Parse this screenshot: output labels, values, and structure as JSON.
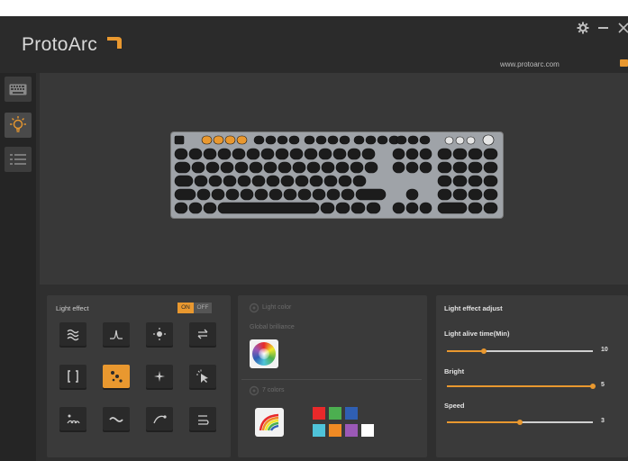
{
  "app": {
    "brand": "ProtoArc",
    "url": "www.protoarc.com",
    "window_controls": {
      "settings_icon": "gear-icon",
      "minimize_icon": "minimize-icon",
      "close_icon": "close-icon"
    }
  },
  "sidebar": {
    "items": [
      {
        "name": "keyboard",
        "icon": "keyboard-icon",
        "active": false
      },
      {
        "name": "lighting",
        "icon": "lightbulb-icon",
        "active": true
      },
      {
        "name": "macro",
        "icon": "list-icon",
        "active": false
      }
    ]
  },
  "light_effect": {
    "title": "Light effect",
    "on_label": "ON",
    "off_label": "OFF",
    "effects": [
      {
        "icon": "wave-icon"
      },
      {
        "icon": "pulse-icon"
      },
      {
        "icon": "sun-icon"
      },
      {
        "icon": "swap-arrows-icon"
      },
      {
        "icon": "bracket-icon"
      },
      {
        "icon": "dots-icon",
        "selected": true
      },
      {
        "icon": "sparkle-icon"
      },
      {
        "icon": "cursor-click-icon"
      },
      {
        "icon": "ripple-icon"
      },
      {
        "icon": "snake-icon"
      },
      {
        "icon": "curve-icon"
      },
      {
        "icon": "loop-arrows-icon"
      }
    ]
  },
  "light_color": {
    "title": "Light color",
    "subtitle": "Global brilliance",
    "section2_title": "7 colors",
    "swatches": [
      "#e8292a",
      "#4caf50",
      "#2f5fb3",
      "#4fc3d9",
      "#f08a24",
      "#9b59b6",
      "#ffffff"
    ]
  },
  "adjust": {
    "title": "Light effect adjust",
    "sliders": [
      {
        "label": "Light alive time(Min)",
        "value": "10",
        "level": 0.25
      },
      {
        "label": "Bright",
        "value": "5",
        "level": 1.0
      },
      {
        "label": "Speed",
        "value": "3",
        "level": 0.5
      }
    ]
  },
  "colors": {
    "accent": "#e9982f",
    "background": "#2e2e2e"
  }
}
